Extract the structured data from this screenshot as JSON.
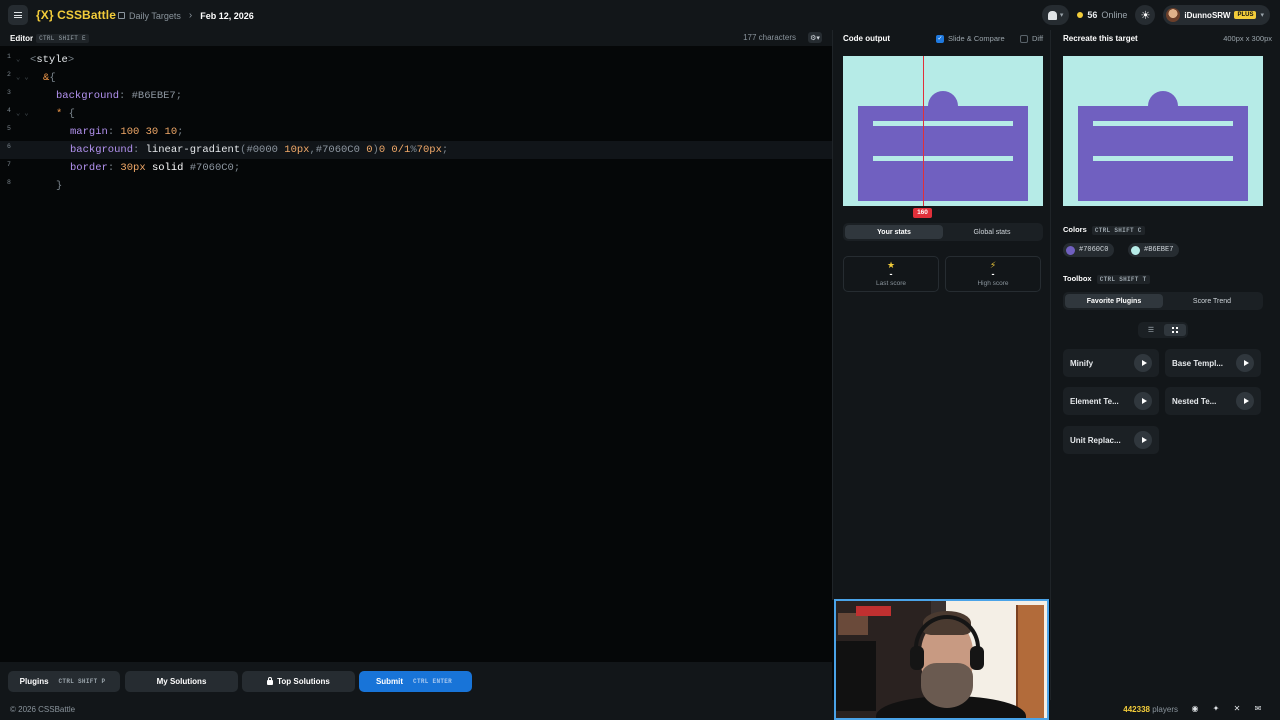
{
  "topbar": {
    "logo": "{X} CSSBattle",
    "breadcrumb_parent": "Daily Targets",
    "breadcrumb_sep": "›",
    "breadcrumb_current": "Feb 12, 2026",
    "online_count": "56",
    "online_label": "Online",
    "username": "iDunnoSRW",
    "plan_badge": "PLUS"
  },
  "editor": {
    "title": "Editor",
    "shortcut": "CTRL SHIFT E",
    "char_count": "177 characters",
    "lines": [
      {
        "n": "1",
        "fold": true
      },
      {
        "n": "2",
        "fold": true
      },
      {
        "n": "3",
        "fold": false
      },
      {
        "n": "4",
        "fold": true
      },
      {
        "n": "5",
        "fold": false
      },
      {
        "n": "6",
        "fold": false,
        "active": true
      },
      {
        "n": "7",
        "fold": false
      },
      {
        "n": "8",
        "fold": false
      }
    ],
    "code": {
      "l1_open": "<",
      "l1_tag": "style",
      "l1_close": ">",
      "l2_amp": "&",
      "l2_brace": "{",
      "l3_prop": "background",
      "l3_colon": ": ",
      "l3_val": "#B6EBE7",
      "l3_semi": ";",
      "l4_star": "*",
      "l4_brace": " {",
      "l5_prop": "margin",
      "l5_colon": ": ",
      "l5_val": "100 30 10",
      "l5_semi": ";",
      "l6_prop": "background",
      "l6_colon": ": ",
      "l6_fn": "linear-gradient",
      "l6_p1": "(",
      "l6_c1": "#0000",
      "l6_n1": " 10",
      "l6_u1": "px",
      "l6_comma": ",",
      "l6_c2": "#7060C0",
      "l6_n2": " 0",
      "l6_p2": ")",
      "l6_n3": "0 0/1",
      "l6_pct": "%",
      "l6_n4": "70",
      "l6_u2": "px",
      "l6_semi": ";",
      "l7_prop": "border",
      "l7_colon": ": ",
      "l7_n": "30",
      "l7_u": "px",
      "l7_kw": " solid ",
      "l7_c": "#7060C0",
      "l7_semi": ";",
      "l8_brace": "}"
    }
  },
  "bottom_bar": {
    "plugins_label": "Plugins",
    "plugins_shortcut": "CTRL SHIFT P",
    "my_solutions": "My Solutions",
    "top_solutions": "Top Solutions",
    "submit_label": "Submit",
    "submit_shortcut": "CTRL ENTER"
  },
  "output": {
    "title": "Code output",
    "slide_compare": "Slide & Compare",
    "slide_compare_checked": true,
    "diff": "Diff",
    "diff_checked": false,
    "slider_value": "160",
    "tabs": [
      "Your stats",
      "Global stats"
    ],
    "active_tab": 0,
    "last_score_value": "-",
    "last_score_label": "Last score",
    "high_score_value": "-",
    "high_score_label": "High score"
  },
  "target": {
    "title": "Recreate this target",
    "size": "400px x 300px",
    "colors_title": "Colors",
    "colors_shortcut": "CTRL SHIFT C",
    "colors": [
      "#7060C0",
      "#B6EBE7"
    ],
    "toolbox_title": "Toolbox",
    "toolbox_shortcut": "CTRL SHIFT T",
    "toolbox_tabs": [
      "Favorite Plugins",
      "Score Trend"
    ],
    "plugins": [
      "Minify",
      "Base Templ...",
      "Element Te...",
      "Nested Te...",
      "Unit Replac..."
    ]
  },
  "footer": {
    "copyright": "© 2026 CSSBattle",
    "players_count": "442338",
    "players_label": "players"
  },
  "theme": {
    "bg": "#050708",
    "panel": "#121619",
    "accent": "#f2cc3a",
    "primary": "#1874d8",
    "target_bg": "#B6EBE7",
    "target_fg": "#7060C0"
  }
}
